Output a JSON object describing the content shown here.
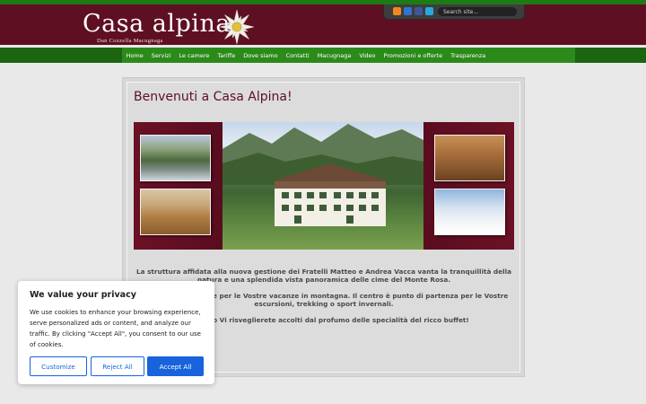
{
  "header": {
    "logo_title": "Casa alpina",
    "logo_subtitle": "Dan Cozzella   Macugnaga",
    "search_placeholder": "Search site...",
    "social_icons": [
      "rss-icon",
      "delicious-icon",
      "facebook-icon",
      "twitter-icon"
    ]
  },
  "nav": {
    "items": [
      "Home",
      "Servizi",
      "Le camere",
      "Tariffe",
      "Dove siamo",
      "Contatti",
      "Macugnaga",
      "Video",
      "Promozioni e offerte",
      "Trasparenza"
    ]
  },
  "main": {
    "title": "Benvenuti a Casa Alpina!",
    "paragraphs": [
      "La struttura affidata alla nuova gestione dei Fratelli Matteo e Andrea Vacca vanta la tranquillità della natura e una splendida vista panoramica delle cime del Monte Rosa.",
      "E' la soluzione ideale per le Vostre vacanze in montagna. Il centro è punto di partenza per le Vostre escursioni, trekking o sport invernali.",
      "Al mattino Vi risveglierete accolti  dal profumo delle specialità del ricco buffet!"
    ]
  },
  "cookie": {
    "title": "We value your privacy",
    "text": "We use cookies to enhance your browsing experience, serve personalized ads or content, and analyze our traffic. By clicking \"Accept All\", you consent to our use of cookies.",
    "customize_label": "Customize",
    "reject_label": "Reject All",
    "accept_label": "Accept All"
  },
  "colors": {
    "brand_maroon": "#5f0f22",
    "nav_green": "#2b8a1a",
    "accept_blue": "#1863dc"
  }
}
